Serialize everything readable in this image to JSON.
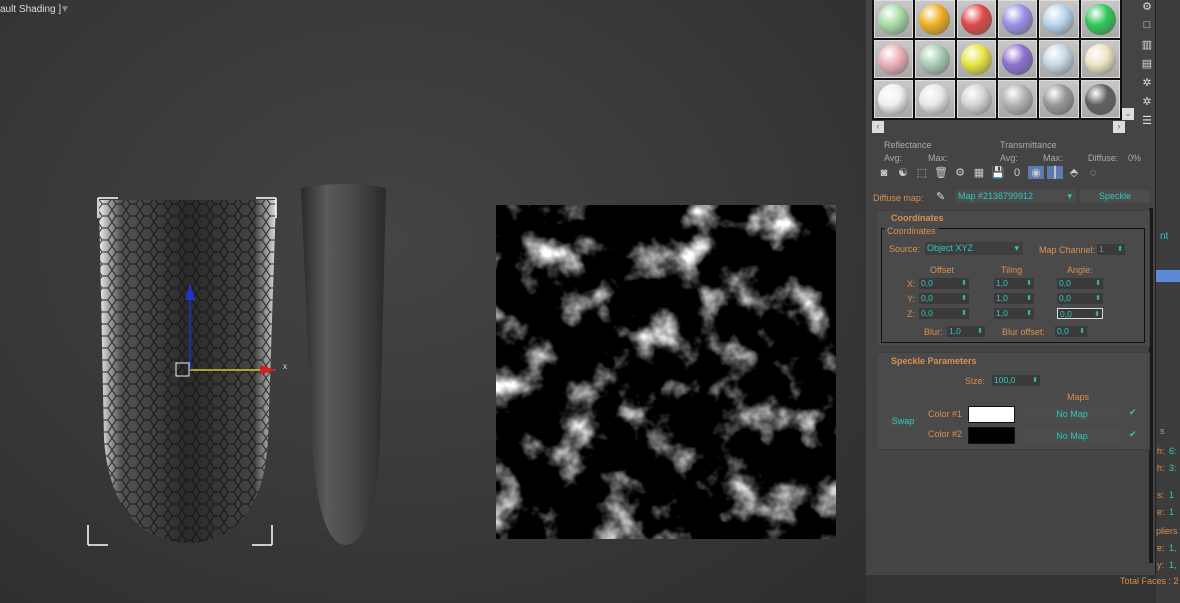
{
  "viewport": {
    "label": "ault Shading ]",
    "filter_icon": "filter-icon"
  },
  "axes": {
    "x": "x"
  },
  "slots": [
    "#a8dca8",
    "#f0b020",
    "#e04848",
    "#9890e8",
    "#b8d4ec",
    "#30c858",
    "#ecb0b8",
    "#a8ccb4",
    "#e8e440",
    "#8c70d0",
    "#c8d8e4",
    "#ece4c4",
    "#f0f0f0",
    "#e8e8e8",
    "#d4d4d4",
    "#b4b4b4",
    "#989898",
    "#606060"
  ],
  "sidebar_icons": [
    "pick-material-icon",
    "sample-type-icon",
    "backlight-icon",
    "background-icon",
    "uv-tiling-icon",
    "video-check-icon",
    "make-preview-icon"
  ],
  "reflect": {
    "reflectance": "Reflectance",
    "transmittance": "Transmittance",
    "avg": "Avg:",
    "max": "Max:",
    "diffuse": "Diffuse:",
    "diffuse_val": "0%"
  },
  "toolbar": [
    "◙",
    "☯",
    "⬚",
    "🗑",
    "⚙",
    "▦",
    "💾",
    "0",
    "◉",
    "┃",
    "⬘",
    "◌"
  ],
  "map": {
    "label": "Diffuse map:",
    "name": "Map #2138799912",
    "type": "Speckle"
  },
  "coords": {
    "title": "Coordinates",
    "group": "Coordinates",
    "source_label": "Source:",
    "source": "Object XYZ",
    "channel_label": "Map Channel:",
    "channel": "1",
    "headers": [
      "Offset",
      "Tiling",
      "Angle:"
    ],
    "rows": [
      {
        "axis": "X:",
        "offset": "0,0",
        "tiling": "1,0",
        "angle": "0,0"
      },
      {
        "axis": "Y:",
        "offset": "0,0",
        "tiling": "1,0",
        "angle": "0,0"
      },
      {
        "axis": "Z:",
        "offset": "0,0",
        "tiling": "1,0",
        "angle": "0,0"
      }
    ],
    "blur_label": "Blur:",
    "blur": "1,0",
    "blur_offset_label": "Blur offset:",
    "blur_offset": "0,0"
  },
  "speckle": {
    "title": "Speckle Parameters",
    "size_label": "Size:",
    "size": "100,0",
    "maps_label": "Maps",
    "swap": "Swap",
    "color1_label": "Color #1",
    "color2_label": "Color #2",
    "color1": "#ffffff",
    "color2": "#000000",
    "map1": "No Map",
    "map2": "No Map"
  },
  "cmdpanel": {
    "nt": "nt",
    "s": "s",
    "h1": "h:",
    "v1": "6:",
    "h2": "h:",
    "v2": "3:",
    "s1": "s:",
    "v3": "1",
    "e1": "e:",
    "v4": "1",
    "pliers": "pliers",
    "e2": "e:",
    "v5": "1,",
    "y": "y:",
    "v6": "1,",
    "total_faces": "Total Faces : 2"
  }
}
